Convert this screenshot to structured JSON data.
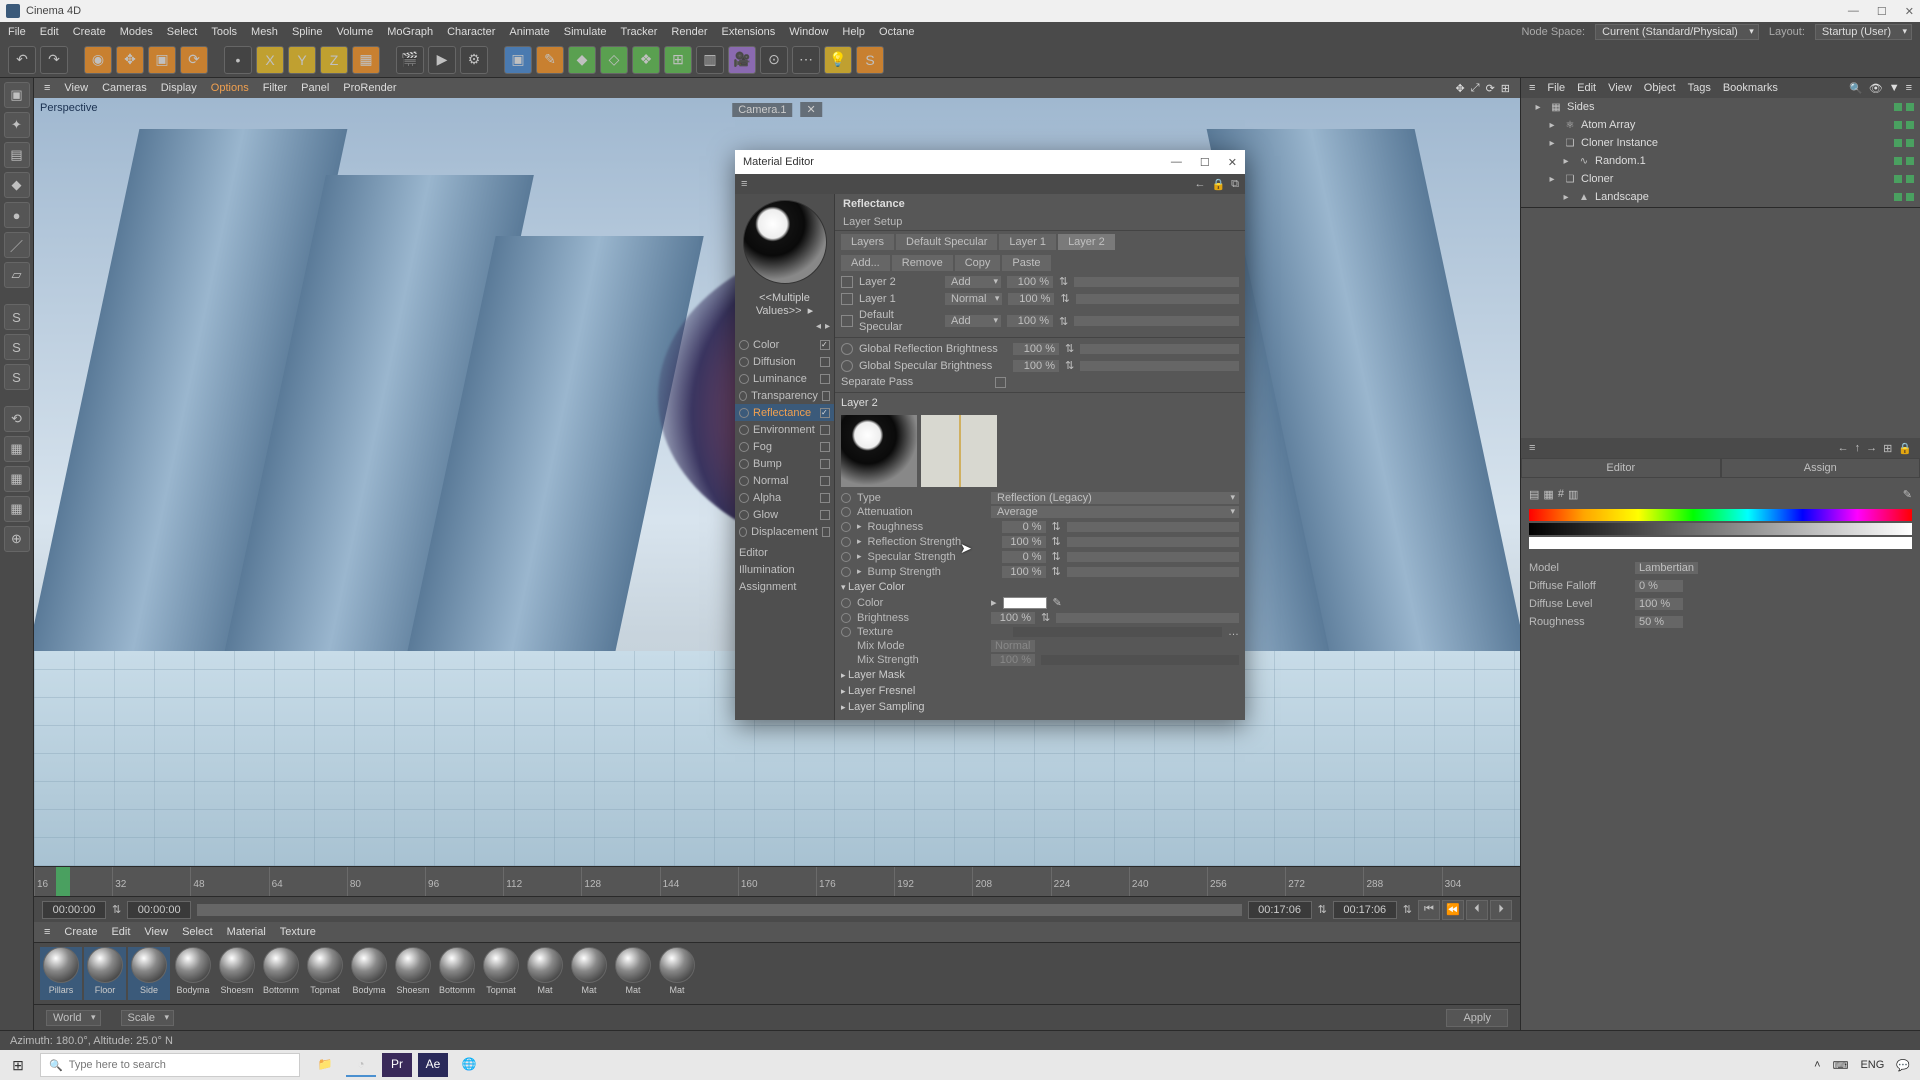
{
  "app": {
    "title": "Cinema 4D"
  },
  "winbtns": {
    "min": "—",
    "max": "☐",
    "close": "✕"
  },
  "main_menu": [
    "File",
    "Edit",
    "Create",
    "Modes",
    "Select",
    "Tools",
    "Mesh",
    "Spline",
    "Volume",
    "MoGraph",
    "Character",
    "Animate",
    "Simulate",
    "Tracker",
    "Render",
    "Extensions",
    "Window",
    "Help",
    "Octane"
  ],
  "main_menu_right": {
    "node_space_k": "Node Space:",
    "node_space_v": "Current (Standard/Physical)",
    "layout_k": "Layout:",
    "layout_v": "Startup (User)"
  },
  "viewport_menu": [
    "View",
    "Cameras",
    "Display",
    "Options",
    "Filter",
    "Panel",
    "ProRender"
  ],
  "viewport_active": "Options",
  "viewport": {
    "projection": "Perspective",
    "camera": "Camera.1"
  },
  "timeline": {
    "ticks": [
      "16",
      "32",
      "48",
      "64",
      "80",
      "96",
      "112",
      "128",
      "144",
      "160",
      "176",
      "192",
      "208",
      "224",
      "240",
      "256",
      "272",
      "288",
      "304"
    ]
  },
  "playbar": {
    "start": "00:00:00",
    "pos": "00:00:00",
    "len": "00:17:06",
    "end": "00:17:06",
    "btns": [
      "⏮",
      "⏪",
      "⏴",
      "⏵"
    ]
  },
  "material_menu": [
    "Create",
    "Edit",
    "View",
    "Select",
    "Material",
    "Texture"
  ],
  "materials": [
    {
      "name": "Pillars",
      "sel": true
    },
    {
      "name": "Floor",
      "sel": true
    },
    {
      "name": "Side",
      "sel": true
    },
    {
      "name": "Bodyma"
    },
    {
      "name": "Shoesm"
    },
    {
      "name": "Bottomm"
    },
    {
      "name": "Topmat"
    },
    {
      "name": "Bodyma"
    },
    {
      "name": "Shoesm"
    },
    {
      "name": "Bottomm"
    },
    {
      "name": "Topmat"
    },
    {
      "name": "Mat"
    },
    {
      "name": "Mat"
    },
    {
      "name": "Mat"
    },
    {
      "name": "Mat"
    }
  ],
  "coordbar": {
    "world": "World",
    "scale": "Scale",
    "apply": "Apply"
  },
  "status": "Azimuth: 180.0°, Altitude: 25.0°  N",
  "objects_menu": [
    "File",
    "Edit",
    "View",
    "Object",
    "Tags",
    "Bookmarks"
  ],
  "objects": [
    {
      "name": "Sides",
      "indent": 0,
      "ic": "▦"
    },
    {
      "name": "Atom Array",
      "indent": 1,
      "ic": "⚛"
    },
    {
      "name": "Cloner Instance",
      "indent": 1,
      "ic": "❑"
    },
    {
      "name": "Random.1",
      "indent": 2,
      "ic": "∿"
    },
    {
      "name": "Cloner",
      "indent": 1,
      "ic": "❑"
    },
    {
      "name": "Landscape",
      "indent": 2,
      "ic": "▲"
    }
  ],
  "attr_tabs": [
    "Editor",
    "Assign"
  ],
  "attr_rows": [
    {
      "l": "Model",
      "v": "Lambertian"
    },
    {
      "l": "Diffuse Falloff",
      "v": "0 %"
    },
    {
      "l": "Diffuse Level",
      "v": "100 %"
    },
    {
      "l": "Roughness",
      "v": "50 %"
    }
  ],
  "mat_editor": {
    "title": "Material Editor",
    "multiple": "<<Multiple Values>>",
    "channels": [
      {
        "n": "Color",
        "on": true
      },
      {
        "n": "Diffusion",
        "on": false
      },
      {
        "n": "Luminance",
        "on": false
      },
      {
        "n": "Transparency",
        "on": false
      },
      {
        "n": "Reflectance",
        "on": true,
        "active": true,
        "sel": true
      },
      {
        "n": "Environment",
        "on": false
      },
      {
        "n": "Fog",
        "on": false
      },
      {
        "n": "Bump",
        "on": false
      },
      {
        "n": "Normal",
        "on": false,
        "tex": true
      },
      {
        "n": "Alpha",
        "on": false
      },
      {
        "n": "Glow",
        "on": false
      },
      {
        "n": "Displacement",
        "on": false
      }
    ],
    "extra": [
      "Editor",
      "Illumination",
      "Assignment"
    ],
    "header": "Reflectance",
    "subheader": "Layer Setup",
    "layer_tabs": [
      "Layers",
      "Default Specular",
      "Layer 1",
      "Layer 2"
    ],
    "layer_tabs_active": "Layer 2",
    "layer_btns": [
      "Add...",
      "Remove",
      "Copy",
      "Paste"
    ],
    "layers": [
      {
        "name": "Layer 2",
        "mode": "Add",
        "pct": "100 %"
      },
      {
        "name": "Layer 1",
        "mode": "Normal",
        "pct": "100 %"
      },
      {
        "name": "Default Specular",
        "mode": "Add",
        "pct": "100 %"
      }
    ],
    "globals": [
      {
        "l": "Global Reflection Brightness",
        "v": "100 %"
      },
      {
        "l": "Global Specular Brightness",
        "v": "100 %"
      }
    ],
    "separate_pass": "Separate Pass",
    "section": "Layer 2",
    "type_l": "Type",
    "type_v": "Reflection (Legacy)",
    "atten_l": "Attenuation",
    "atten_v": "Average",
    "params": [
      {
        "l": "Roughness",
        "v": "0 %"
      },
      {
        "l": "Reflection Strength",
        "v": "100 %"
      },
      {
        "l": "Specular Strength",
        "v": "0 %"
      },
      {
        "l": "Bump Strength",
        "v": "100 %"
      }
    ],
    "layer_color": "Layer Color",
    "color_l": "Color",
    "bright_l": "Brightness",
    "bright_v": "100 %",
    "tex_l": "Texture",
    "mix_mode_l": "Mix Mode",
    "mix_mode_v": "Normal",
    "mix_str_l": "Mix Strength",
    "mix_str_v": "100 %",
    "folds": [
      "Layer Mask",
      "Layer Fresnel",
      "Layer Sampling"
    ]
  },
  "taskbar": {
    "search_placeholder": "Type here to search",
    "lang": "ENG",
    "icons": {
      "up": "˄",
      "net": "⌨"
    }
  }
}
